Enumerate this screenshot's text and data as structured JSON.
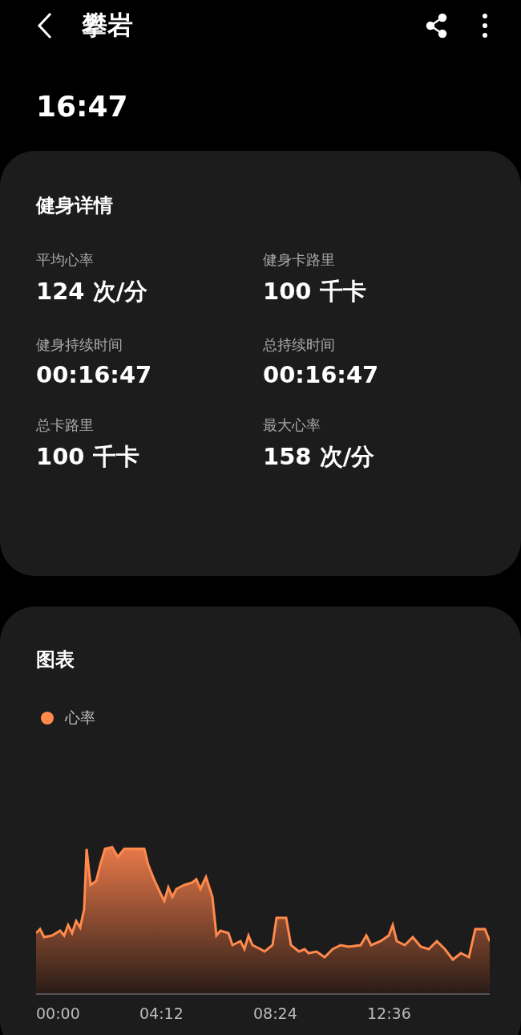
{
  "header": {
    "title": "攀岩"
  },
  "time": "16:47",
  "details": {
    "title": "健身详情",
    "stats": [
      {
        "label": "平均心率",
        "value": "124 次/分"
      },
      {
        "label": "健身卡路里",
        "value": "100 千卡"
      },
      {
        "label": "健身持续时间",
        "value": "00:16:47"
      },
      {
        "label": "总持续时间",
        "value": "00:16:47"
      },
      {
        "label": "总卡路里",
        "value": "100 千卡"
      },
      {
        "label": "最大心率",
        "value": "158 次/分"
      }
    ]
  },
  "chart": {
    "title": "图表",
    "legend": [
      {
        "label": "心率",
        "color": "#ff8a4c"
      }
    ],
    "x_labels": [
      "00:00",
      "04:12",
      "08:24",
      "12:36"
    ]
  }
}
